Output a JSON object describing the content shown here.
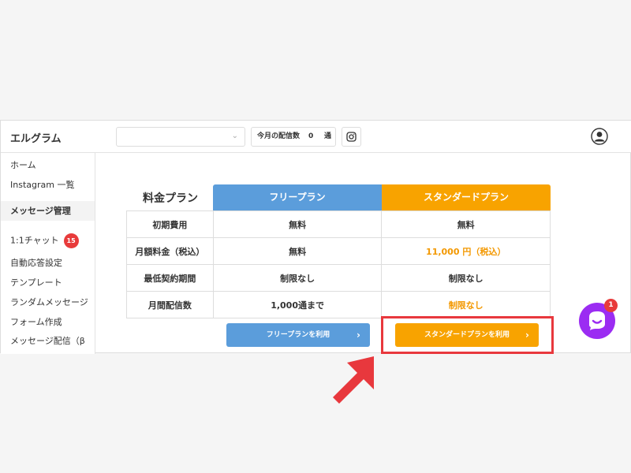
{
  "app": {
    "name": "エルグラム"
  },
  "header": {
    "account_select_value": "",
    "monthly_sends_label": "今月の配信数",
    "monthly_sends_count": "0",
    "monthly_sends_unit": "通",
    "instagram_icon": "instagram-icon",
    "user_icon": "user-avatar-icon"
  },
  "sidebar": {
    "items": [
      {
        "label": "ホーム"
      },
      {
        "label": "Instagram 一覧"
      }
    ],
    "section_header": "メッセージ管理",
    "sub_items": [
      {
        "label": "1:1チャット",
        "badge": "15"
      },
      {
        "label": "自動応答設定"
      },
      {
        "label": "テンプレート"
      },
      {
        "label": "ランダムメッセージ"
      },
      {
        "label": "フォーム作成"
      },
      {
        "label": "メッセージ配信（β"
      }
    ]
  },
  "pricing": {
    "title": "料金プラン",
    "plans": [
      {
        "name": "フリープラン",
        "color": "#5b9ddb"
      },
      {
        "name": "スタンダードプラン",
        "color": "#f8a300"
      }
    ],
    "rows": [
      {
        "label": "初期費用",
        "free": "無料",
        "standard": "無料"
      },
      {
        "label": "月額料金（税込）",
        "free": "無料",
        "standard": "11,000 円（税込）"
      },
      {
        "label": "最低契約期間",
        "free": "制限なし",
        "standard": "制限なし"
      },
      {
        "label": "月間配信数",
        "free": "1,000通まで",
        "standard": "制限なし"
      }
    ],
    "buttons": {
      "free": "フリープランを利用",
      "standard": "スタンダードプランを利用"
    },
    "highlight_color": "#e8383d"
  },
  "chat_widget": {
    "badge": "1",
    "color": "#9b2cf2"
  }
}
